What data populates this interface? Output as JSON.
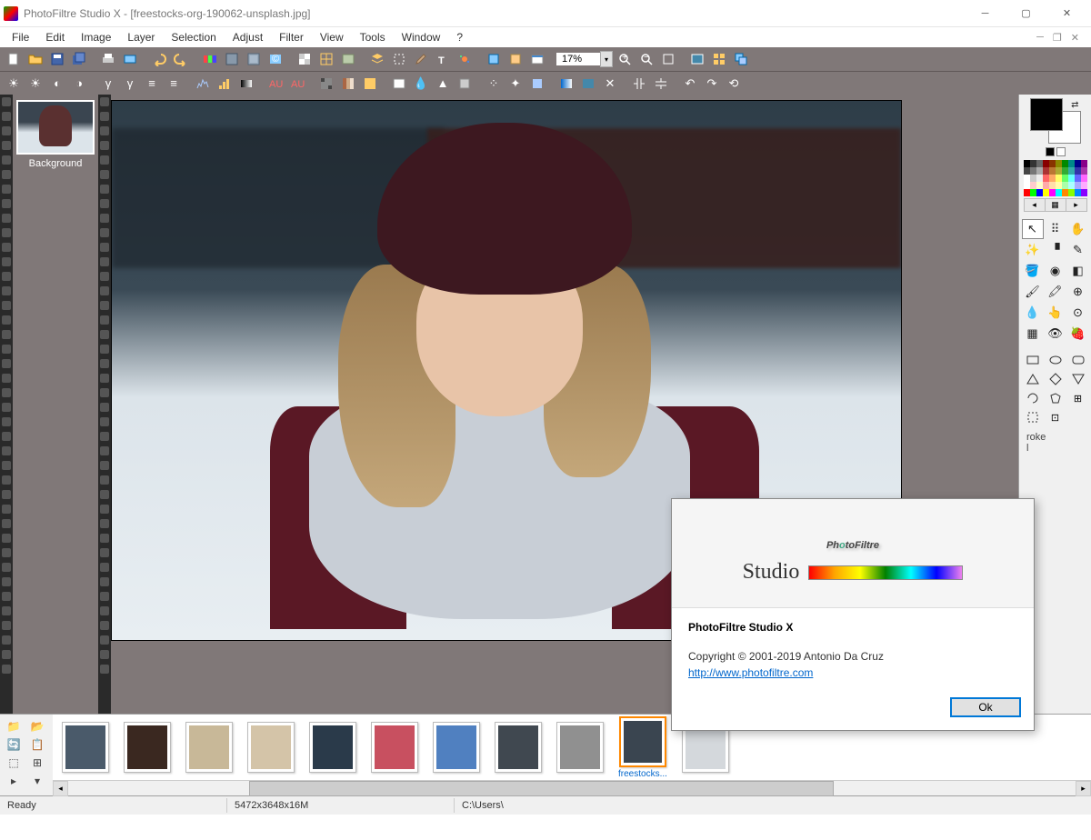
{
  "title": "PhotoFiltre Studio X - [freestocks-org-190062-unsplash.jpg]",
  "menus": [
    "File",
    "Edit",
    "Image",
    "Layer",
    "Selection",
    "Adjust",
    "Filter",
    "View",
    "Tools",
    "Window",
    "?"
  ],
  "zoom": "17%",
  "layer": {
    "label": "Background"
  },
  "about": {
    "logo_left": "Ph",
    "logo_mid": "o",
    "logo_right": "toFiltre",
    "studio": "Studio",
    "title": "PhotoFiltre Studio X",
    "copyright": "Copyright © 2001-2019  Antonio Da Cruz",
    "link_text": "http://www.photofiltre.com",
    "ok": "Ok"
  },
  "thumbs": {
    "selected_caption": "freestocks...",
    "count": 11
  },
  "status": {
    "ready": "Ready",
    "dims": "5472x3648x16M",
    "path": "C:\\Users\\"
  },
  "palette_colors": [
    "#000",
    "#333",
    "#666",
    "#800",
    "#830",
    "#880",
    "#080",
    "#088",
    "#008",
    "#808",
    "#444",
    "#777",
    "#aaa",
    "#a33",
    "#b73",
    "#aa3",
    "#3a3",
    "#3aa",
    "#33a",
    "#a3a",
    "#fff",
    "#ccc",
    "#eee",
    "#f66",
    "#fa6",
    "#ff6",
    "#6f6",
    "#6ff",
    "#66f",
    "#f6f",
    "#fff",
    "#fcc",
    "#ffc",
    "#faa",
    "#fda",
    "#ffa",
    "#afa",
    "#aff",
    "#aaf",
    "#faf",
    "#f00",
    "#0f0",
    "#00f",
    "#ff0",
    "#f0f",
    "#0ff",
    "#f80",
    "#8f0",
    "#08f",
    "#80f"
  ],
  "opt": {
    "stroke": "roke",
    "fill": "l"
  }
}
